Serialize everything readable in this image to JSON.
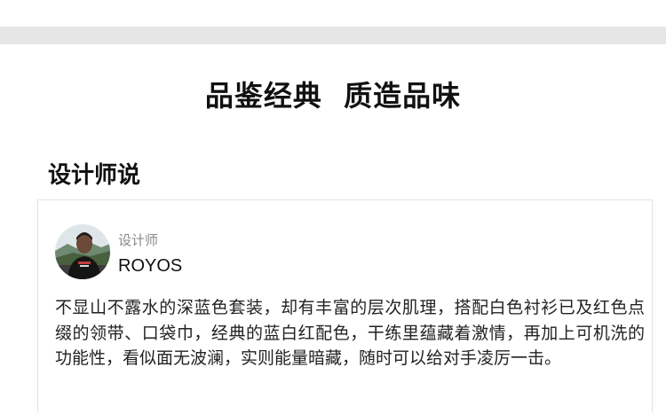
{
  "header": {
    "title": "品鉴经典  质造品味"
  },
  "section": {
    "title": "设计师说"
  },
  "designer": {
    "role": "设计师",
    "name": "ROYOS",
    "avatar_icon": "designer-avatar"
  },
  "quote": {
    "text": "不显山不露水的深蓝色套装，却有丰富的层次肌理，搭配白色衬衫已及红色点缀的领带、口袋巾，经典的蓝白红配色，干练里蕴藏着激情，再加上可机洗的功能性，看似面无波澜，实则能量暗藏，随时可以给对手凌厉一击。"
  },
  "colors": {
    "band": "#e6e6e6",
    "card_border": "#e3e3e3",
    "muted_text": "#888888"
  }
}
